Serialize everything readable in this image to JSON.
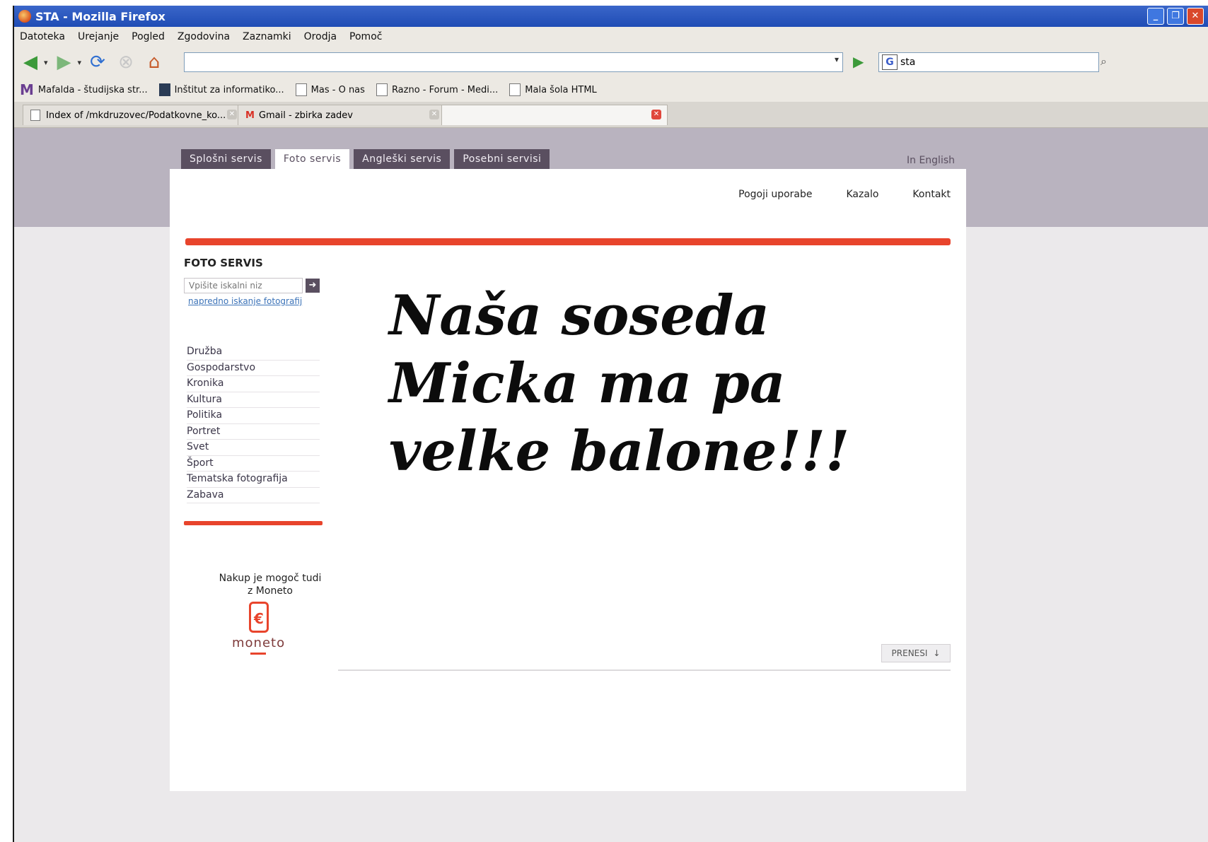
{
  "window": {
    "title": "STA - Mozilla Firefox",
    "controls": {
      "minimize": "_",
      "maximize": "❐",
      "close": "✕"
    }
  },
  "menu": [
    "Datoteka",
    "Urejanje",
    "Pogled",
    "Zgodovina",
    "Zaznamki",
    "Orodja",
    "Pomoč"
  ],
  "navbar": {
    "back_icon": "◀",
    "forward_icon": "▶",
    "reload_icon": "⟳",
    "stop_icon": "⊗",
    "home_icon": "⌂",
    "url": "",
    "go_icon": "▶",
    "search_engine": "G",
    "search_value": "sta",
    "search_icon": "⌕"
  },
  "bookmarks": [
    "Mafalda - študijska str...",
    "Inštitut za informatiko...",
    "Mas - O nas",
    "Razno - Forum - Medi...",
    "Mala šola HTML"
  ],
  "tabs": [
    {
      "label": "Index of /mkdruzovec/Podatkovne_ko..."
    },
    {
      "label": "Gmail - zbirka zadev"
    },
    {
      "label": ""
    }
  ],
  "site": {
    "tabs": [
      "Splošni servis",
      "Foto servis",
      "Angleški servis",
      "Posebni servisi"
    ],
    "in_english": "In English",
    "top_links": [
      "Pogoji uporabe",
      "Kazalo",
      "Kontakt"
    ],
    "section_title": "FOTO SERVIS",
    "search_placeholder": "Vpišite iskalni niz",
    "search_go": "➜",
    "advanced_link": "napredno iskanje fotografij",
    "categories": [
      "Družba",
      "Gospodarstvo",
      "Kronika",
      "Kultura",
      "Politika",
      "Portret",
      "Svet",
      "Šport",
      "Tematska fotografija",
      "Zabava"
    ],
    "moneto_text_1": "Nakup je mogoč tudi",
    "moneto_text_2": "z Moneto",
    "moneto_symbol": "€",
    "moneto_logo": "moneto",
    "handwriting": [
      "Naša soseda",
      "Micka ma pa",
      "velke balone!!!"
    ],
    "download_label": "PRENESI",
    "download_icon": "↓"
  }
}
